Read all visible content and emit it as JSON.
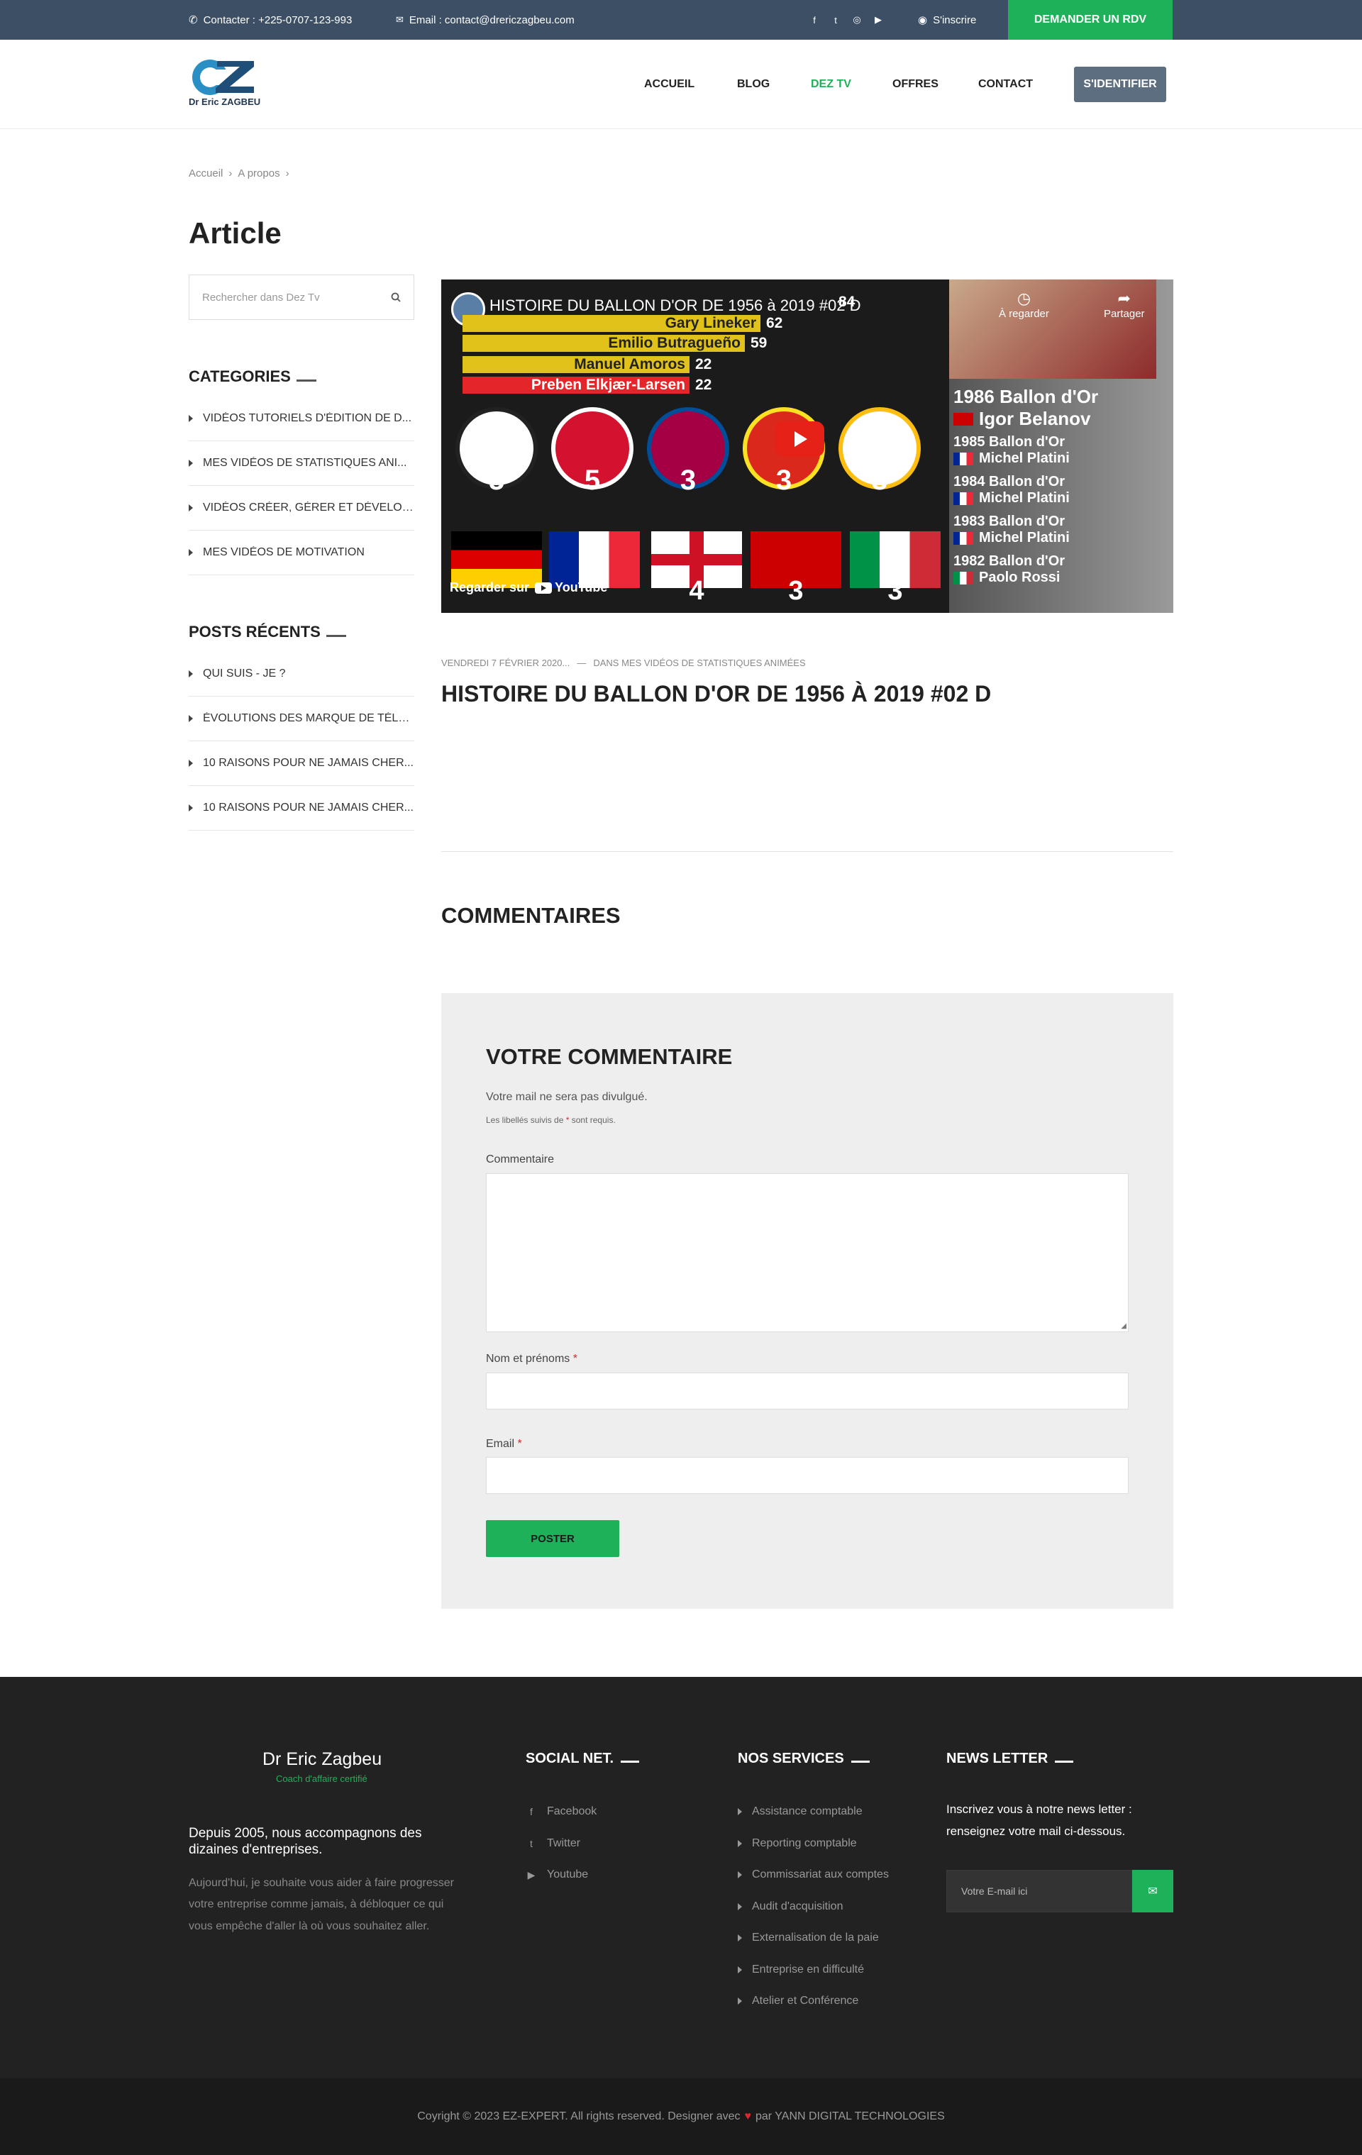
{
  "topbar": {
    "phone": "Contacter : +225-0707-123-993",
    "email": "Email : contact@drericzagbeu.com",
    "social_icons": [
      "facebook-icon",
      "twitter-icon",
      "instagram-icon",
      "youtube-icon"
    ],
    "signup": "S'inscrire",
    "cta": "DEMANDER UN RDV"
  },
  "header": {
    "logo_text": "Dr Eric ZAGBEU",
    "nav": [
      "ACCUEIL",
      "BLOG",
      "DEZ TV",
      "OFFRES",
      "CONTACT"
    ],
    "active_nav": "DEZ TV",
    "login": "S'IDENTIFIER"
  },
  "breadcrumb": [
    "Accueil",
    "A propos"
  ],
  "page_title": "Article",
  "sidebar": {
    "search_placeholder": "Rechercher dans Dez Tv",
    "categories_title": "CATEGORIES",
    "categories": [
      "VIDÉOS TUTORIELS D'ÉDITION DE D...",
      "MES VIDÉOS DE STATISTIQUES ANI...",
      "VIDÉOS CRÉER, GÉRER ET DÉVELOP...",
      "MES VIDÉOS DE MOTIVATION"
    ],
    "recent_title": "POSTS RÉCENTS",
    "recent": [
      "QUI SUIS - JE ?",
      "ÉVOLUTIONS DES MARQUE DE TÉLÉ...",
      "10 RAISONS POUR NE JAMAIS CHER...",
      "10 RAISONS POUR NE JAMAIS CHER..."
    ]
  },
  "video": {
    "title": "HISTOIRE DU BALLON D'OR DE 1956 à 2019 #02 D",
    "bars": [
      {
        "name": "Gary Lineker",
        "value": "62"
      },
      {
        "name": "Emilio Butragueño",
        "value": "59"
      },
      {
        "name": "Manuel Amoros",
        "value": "22"
      },
      {
        "name": "Preben Elkjær-Larsen",
        "value": "22"
      }
    ],
    "top_right_value": "84",
    "clubs": [
      "5",
      "5",
      "3",
      "3",
      "3"
    ],
    "flags": [
      "4",
      "3",
      "3"
    ],
    "watch_later": "À regarder",
    "share": "Partager",
    "watch_on": "Regarder sur",
    "youtube": "YouTube",
    "awards": [
      {
        "year": "1986 Ballon d'Or",
        "name": "Igor Belanov"
      },
      {
        "year": "1985 Ballon d'Or",
        "name": "Michel Platini"
      },
      {
        "year": "1984 Ballon d'Or",
        "name": "Michel Platini"
      },
      {
        "year": "1983 Ballon d'Or",
        "name": "Michel Platini"
      },
      {
        "year": "1982 Ballon d'Or",
        "name": "Paolo Rossi"
      }
    ]
  },
  "post": {
    "date": "VENDREDI 7 FÉVRIER 2020...",
    "category": "DANS MES VIDÉOS DE STATISTIQUES ANIMÉES",
    "title": "HISTOIRE DU BALLON D'OR DE 1956 À 2019 #02 D"
  },
  "comments": {
    "title": "COMMENTAIRES",
    "form_title": "VOTRE COMMENTAIRE",
    "note": "Votre mail ne sera pas divulgué.",
    "required_prefix": "Les libellés suivis de",
    "required_suffix": "sont requis.",
    "comment_label": "Commentaire",
    "name_label": "Nom et prénoms",
    "email_label": "Email",
    "submit": "POSTER"
  },
  "footer": {
    "name": "Dr Eric Zagbeu",
    "subtitle": "Coach d'affaire certifié",
    "lead": "Depuis 2005, nous accompagnons des dizaines d'entreprises.",
    "desc": "Aujourd'hui, je souhaite vous aider à faire progresser votre entreprise comme jamais, à débloquer ce qui vous empêche d'aller là où vous souhaitez aller.",
    "social_title": "SOCIAL NET.",
    "social": [
      {
        "icon": "facebook-icon",
        "label": "Facebook"
      },
      {
        "icon": "twitter-icon",
        "label": "Twitter"
      },
      {
        "icon": "youtube-icon",
        "label": "Youtube"
      }
    ],
    "services_title": "NOS SERVICES",
    "services": [
      "Assistance comptable",
      "Reporting comptable",
      "Commissariat aux comptes",
      "Audit d'acquisition",
      "Externalisation de la paie",
      "Entreprise en difficulté",
      "Atelier et Conférence"
    ],
    "newsletter_title": "NEWS LETTER",
    "newsletter_text": "Inscrivez vous à notre news letter : renseignez votre mail ci-dessous.",
    "newsletter_placeholder": "Votre E-mail ici",
    "copyright_prefix": "Coyright © 2023 EZ-EXPERT. All rights reserved. Designer avec",
    "copyright_suffix": "par YANN DIGITAL TECHNOLOGIES"
  },
  "colors": {
    "topbar": "#3d4f65",
    "accent": "#1fb15a",
    "login": "#5d6e80",
    "footer": "#222222"
  }
}
